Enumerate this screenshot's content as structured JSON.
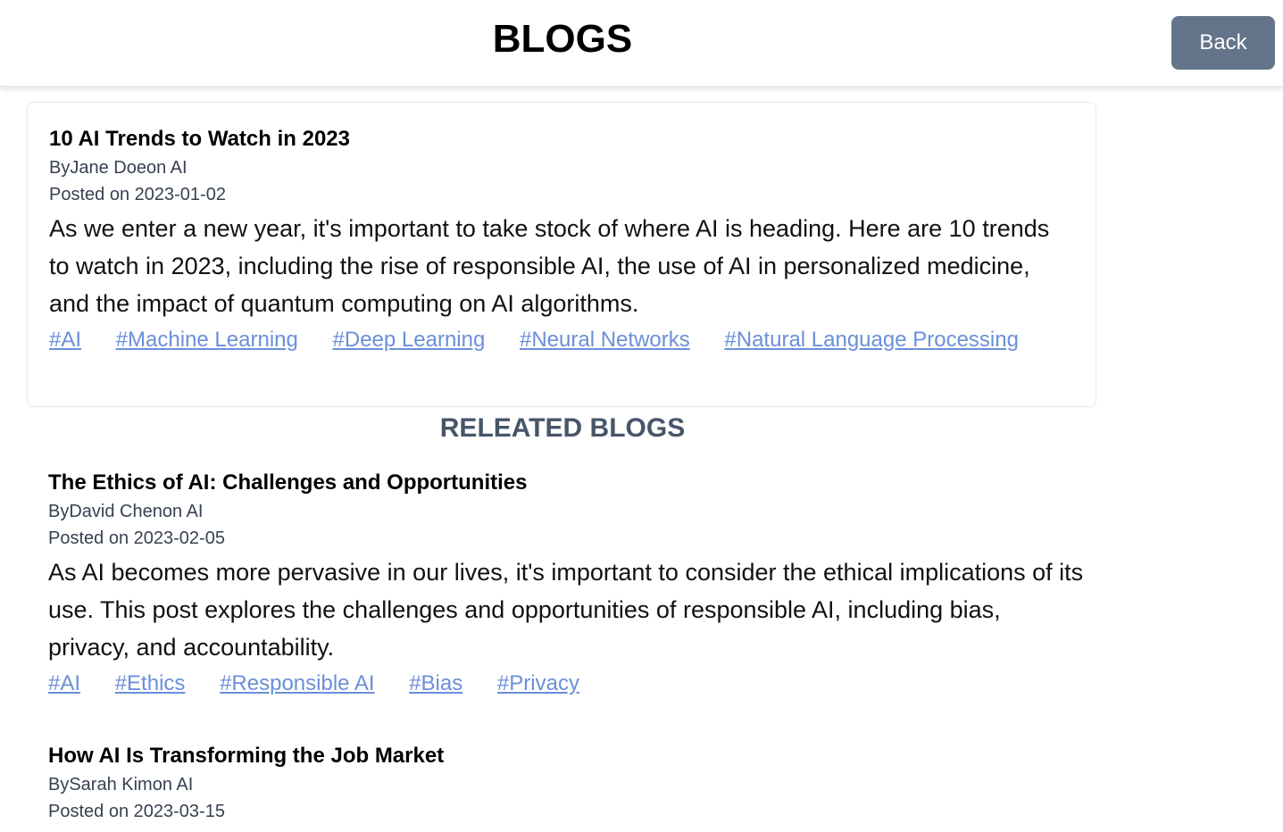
{
  "header": {
    "title": "BLOGS",
    "back_label": "Back"
  },
  "main_post": {
    "title": "10 AI Trends to Watch in 2023",
    "author_prefix": "By",
    "author": "Jane Doe",
    "category_prefix": "on",
    "category": "AI",
    "date_prefix": "Posted on",
    "date": "2023-01-02",
    "body": "As we enter a new year, it's important to take stock of where AI is heading. Here are 10 trends to watch in 2023, including the rise of responsible AI, the use of AI in personalized medicine, and the impact of quantum computing on AI algorithms.",
    "tags": [
      "#AI",
      "#Machine Learning",
      "#Deep Learning",
      "#Neural Networks",
      "#Natural Language Processing"
    ]
  },
  "related": {
    "title": "RELEATED BLOGS",
    "posts": [
      {
        "title": "The Ethics of AI: Challenges and Opportunities",
        "author_prefix": "By",
        "author": "David Chen",
        "category_prefix": "on",
        "category": "AI",
        "date_prefix": "Posted on",
        "date": "2023-02-05",
        "body": "As AI becomes more pervasive in our lives, it's important to consider the ethical implications of its use. This post explores the challenges and opportunities of responsible AI, including bias, privacy, and accountability.",
        "tags": [
          "#AI",
          "#Ethics",
          "#Responsible AI",
          "#Bias",
          "#Privacy"
        ]
      },
      {
        "title": "How AI Is Transforming the Job Market",
        "author_prefix": "By",
        "author": "Sarah Kim",
        "category_prefix": "on",
        "category": "AI",
        "date_prefix": "Posted on",
        "date": "2023-03-15"
      }
    ]
  },
  "colors": {
    "back_button": "#64748b",
    "tag_link": "#6b8fd8",
    "related_heading": "#475569"
  }
}
